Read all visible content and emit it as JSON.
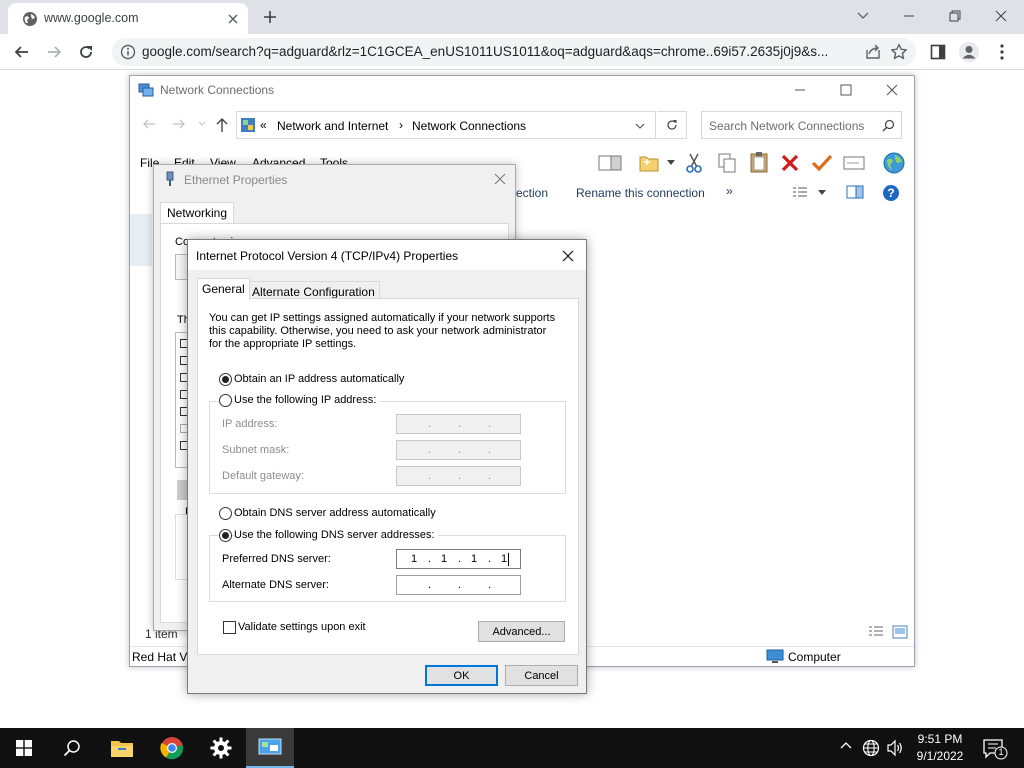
{
  "browser": {
    "tab_title": "www.google.com",
    "url": "google.com/search?q=adguard&rlz=1C1GCEA_enUS1011US1011&oq=adguard&aqs=chrome..69i57.2635j0j9&s..."
  },
  "network_window": {
    "title": "Network Connections",
    "breadcrumb_sep": "«",
    "breadcrumb": [
      "Network and Internet",
      "Network Connections"
    ],
    "search_placeholder": "Search Network Connections",
    "menu": [
      "File",
      "Edit",
      "View",
      "Advanced",
      "Tools"
    ],
    "commands": [
      "ection",
      "Rename this connection",
      "»"
    ],
    "status_items": "1 item",
    "status_left": "Red Hat Vi",
    "status_computer": "Computer"
  },
  "ethernet_window": {
    "title": "Ethernet Properties",
    "tab": "Networking",
    "connect_using_label": "Connect using:",
    "components_label": "Th",
    "desc_label": "D"
  },
  "ipv4_dialog": {
    "title": "Internet Protocol Version 4 (TCP/IPv4) Properties",
    "tabs": [
      "General",
      "Alternate Configuration"
    ],
    "intro_line1": "You can get IP settings assigned automatically if your network supports",
    "intro_line2": "this capability. Otherwise, you need to ask your network administrator",
    "intro_line3": "for the appropriate IP settings.",
    "radio_ip_auto": "Obtain an IP address automatically",
    "radio_ip_manual": "Use the following IP address:",
    "ip_address_label": "IP address:",
    "subnet_mask_label": "Subnet mask:",
    "default_gateway_label": "Default gateway:",
    "radio_dns_auto": "Obtain DNS server address automatically",
    "radio_dns_manual": "Use the following DNS server addresses:",
    "preferred_dns_label": "Preferred DNS server:",
    "preferred_dns_value": [
      "1",
      "1",
      "1",
      "1"
    ],
    "alternate_dns_label": "Alternate DNS server:",
    "validate_label": "Validate settings upon exit",
    "advanced_button": "Advanced...",
    "ok_button": "OK",
    "cancel_button": "Cancel"
  },
  "taskbar": {
    "time": "9:51 PM",
    "date": "9/1/2022",
    "notification_count": "1"
  },
  "colors": {
    "accent": "#0078d7",
    "taskbar": "#101010",
    "chrome_tabbar": "#dee1e6"
  }
}
